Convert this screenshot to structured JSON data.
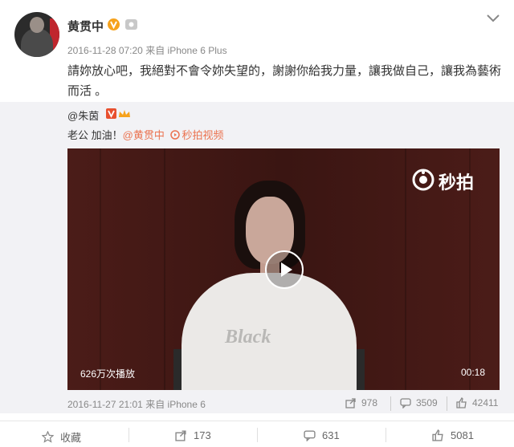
{
  "post": {
    "author": "黄贯中",
    "meta": "2016-11-28 07:20 来自 iPhone 6 Plus",
    "text": "請妳放心吧，我絕對不會令妳失望的，謝謝你給我力量，讓我做自己，讓我為藝術而活 。"
  },
  "repost": {
    "author": "@朱茵",
    "text_prefix": "老公 加油！",
    "mention": "@黄贯中",
    "video_link": "秒拍视频",
    "video": {
      "brand": "秒拍",
      "shirt_text": "Black",
      "views": "626万次播放",
      "duration": "00:18"
    },
    "meta": "2016-11-27 21:01 来自 iPhone 6",
    "reposts": "978",
    "comments": "3509",
    "likes": "42411"
  },
  "actions": {
    "favorite": "收藏",
    "repost": "173",
    "comment": "631",
    "like": "5081"
  },
  "colors": {
    "link": "#eb7350",
    "vip": "#f6a21c",
    "muted": "#888888"
  },
  "icons": [
    "verified-v-icon",
    "vip-member-icon",
    "chevron-down-icon",
    "crown-icon",
    "play-icon",
    "miaopai-logo-icon",
    "share-icon",
    "comment-icon",
    "like-icon",
    "star-icon"
  ]
}
